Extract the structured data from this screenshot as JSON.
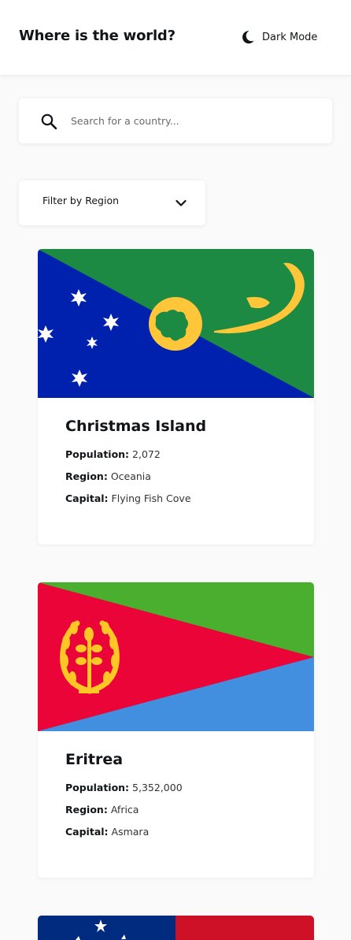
{
  "header": {
    "title": "Where is the world?",
    "theme_toggle_label": "Dark Mode"
  },
  "search": {
    "value": "",
    "placeholder": "Search for a country..."
  },
  "filter": {
    "label": "Filter by Region"
  },
  "field_labels": {
    "population": "Population:",
    "region": "Region:",
    "capital": "Capital:"
  },
  "countries": [
    {
      "name": "Christmas Island",
      "population": "2,072",
      "region": "Oceania",
      "capital": "Flying Fish Cove"
    },
    {
      "name": "Eritrea",
      "population": "5,352,000",
      "region": "Africa",
      "capital": "Asmara"
    }
  ],
  "colors": {
    "background": "#fafafa",
    "surface": "#ffffff",
    "text": "#111517"
  },
  "icons": [
    "moon-icon",
    "search-icon",
    "chevron-down-icon"
  ]
}
